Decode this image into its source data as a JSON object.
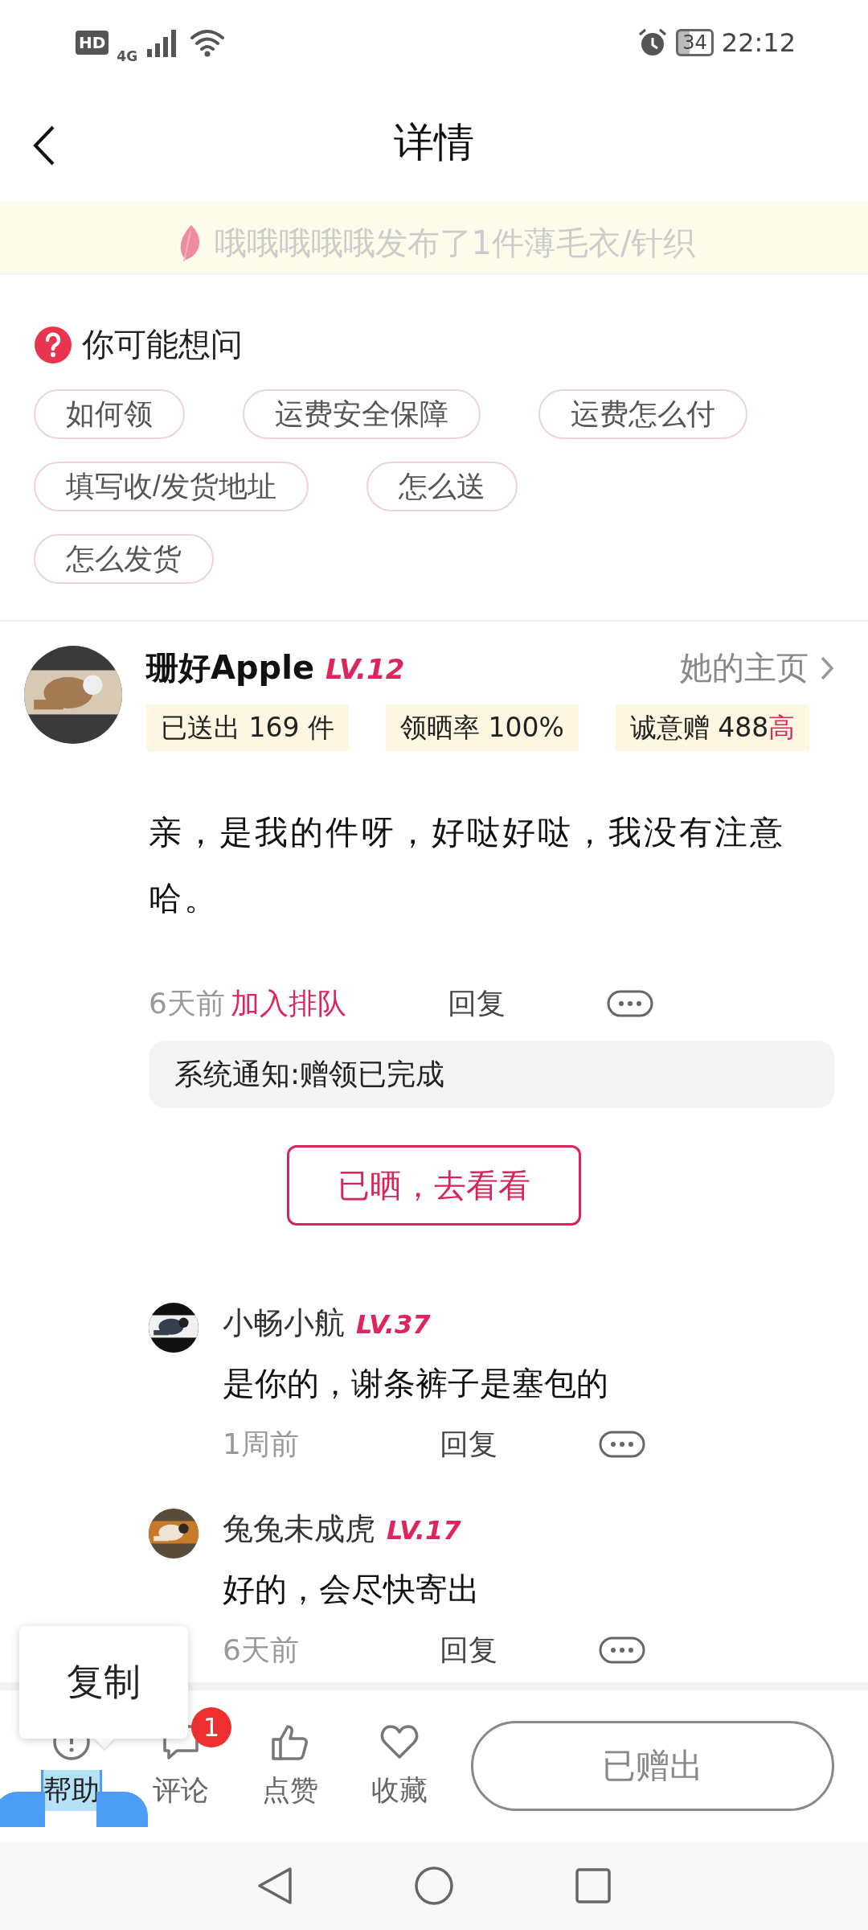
{
  "status_bar": {
    "badges": [
      "HD",
      "4G"
    ],
    "battery": "34",
    "time": "22:12"
  },
  "header": {
    "title": "详情"
  },
  "ticker": {
    "lines": [
      "哦哦哦哦哦发布了1件薄毛衣/针织"
    ]
  },
  "faq": {
    "title": "你可能想问",
    "chip_rows": [
      [
        "如何领",
        "运费安全保障",
        "运费怎么付"
      ],
      [
        "填写收/发货地址",
        "怎么送"
      ],
      [
        "怎么发货"
      ]
    ]
  },
  "post": {
    "author": {
      "name": "珊好Apple",
      "level": "LV.12",
      "profile_link": "她的主页"
    },
    "stats": [
      {
        "label": "已送出 169 件"
      },
      {
        "label": "领晒率 100%"
      },
      {
        "label": "诚意赠 488 ",
        "highlight": "高"
      }
    ],
    "text": "亲，是我的件呀，好哒好哒，我没有注意哈。",
    "time": "6天前",
    "queue_link": "加入排队",
    "reply": "回复",
    "system_notice": "系统通知:赠领已完成",
    "show_button": "已晒，去看看"
  },
  "replies": [
    {
      "name": "小畅小航",
      "level": "LV.37",
      "text": "是你的，谢条裤子是塞包的",
      "time": "1周前",
      "reply": "回复"
    },
    {
      "name": "兔兔未成虎",
      "level": "LV.17",
      "text": "好的，会尽快寄出",
      "time": "6天前",
      "reply": "回复"
    }
  ],
  "bottom_bar": {
    "actions": [
      {
        "kind": "help",
        "label": "帮助",
        "text_selected": true
      },
      {
        "kind": "comment",
        "label": "评论",
        "text_selected": false,
        "badge": "1"
      },
      {
        "kind": "like",
        "label": "点赞",
        "text_selected": false
      },
      {
        "kind": "favorite",
        "label": "收藏",
        "text_selected": false
      }
    ],
    "main_button": "已赠出"
  },
  "context_menu": {
    "items": [
      "复制"
    ]
  }
}
